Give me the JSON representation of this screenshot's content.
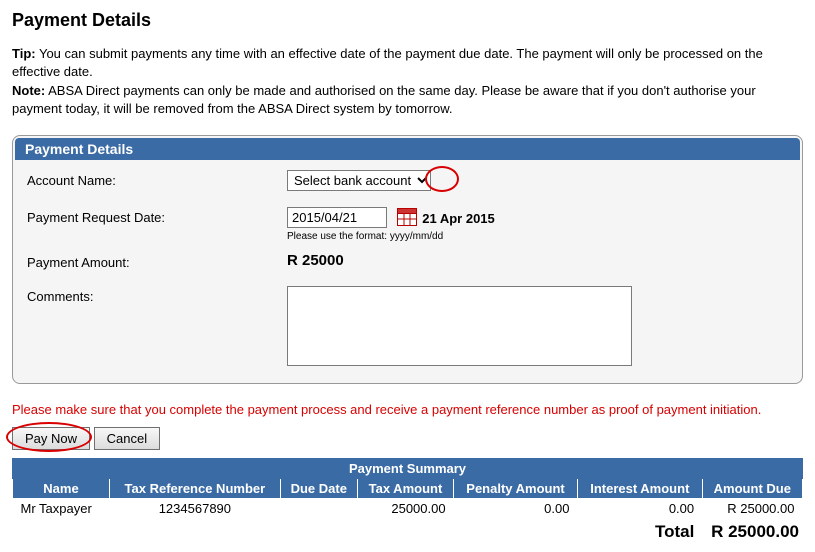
{
  "page": {
    "title": "Payment Details",
    "tip_label": "Tip:",
    "tip_text": " You can submit payments any time with an effective date of the payment due date. The payment will only be processed on the effective date.",
    "note_label": "Note:",
    "note_text": " ABSA Direct payments can only be made and authorised on the same day. Please be aware that if you don't authorise your payment today, it will be removed from the ABSA Direct system by tomorrow."
  },
  "panel": {
    "header": "Payment Details",
    "account_name_label": "Account Name:",
    "account_selected": "Select bank account",
    "request_date_label": "Payment Request Date:",
    "request_date_value": "2015/04/21",
    "request_date_display": "21 Apr 2015",
    "format_hint": "Please use the format: yyyy/mm/dd",
    "amount_label": "Payment Amount:",
    "amount_value": "R 25000",
    "comments_label": "Comments:",
    "comments_value": ""
  },
  "warning": "Please make sure that you complete the payment process and receive a payment reference number as proof of payment initiation.",
  "buttons": {
    "pay_now": "Pay Now",
    "cancel": "Cancel"
  },
  "summary": {
    "title": "Payment Summary",
    "headers": {
      "name": "Name",
      "tax_ref": "Tax Reference Number",
      "due_date": "Due Date",
      "tax_amount": "Tax Amount",
      "penalty": "Penalty Amount",
      "interest": "Interest Amount",
      "amount_due": "Amount Due"
    },
    "row": {
      "name": "Mr Taxpayer",
      "tax_ref": "1234567890",
      "due_date": "",
      "tax_amount": "25000.00",
      "penalty": "0.00",
      "interest": "0.00",
      "amount_due": "R 25000.00"
    },
    "total_label": "Total",
    "total_value": "R 25000.00"
  }
}
